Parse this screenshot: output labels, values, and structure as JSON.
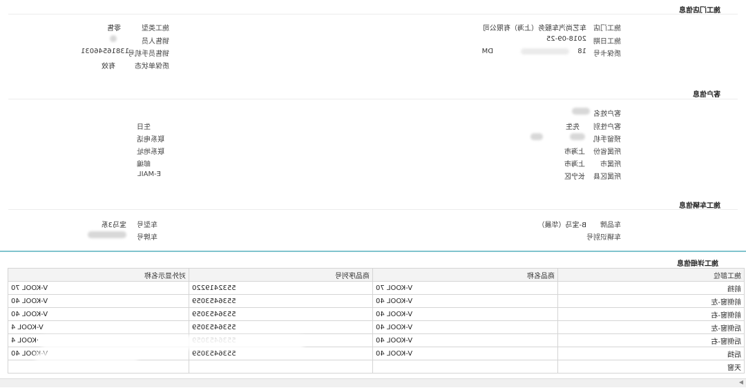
{
  "store_section": {
    "title": "施工门店信息",
    "store_label": "施工门店",
    "store_value": "车艺尚汽车服务（上海）有限公司",
    "date_label": "施工日期",
    "date_value": "2018-09-25",
    "warranty_label": "质保卡号",
    "warranty_value_prefix": "18",
    "warranty_value_suffix": "DM",
    "type_label": "施工类型",
    "type_value": "零售",
    "sales_label": "销售人员",
    "sales_phone_label": "销售员手机号",
    "sales_phone_value": "13816546031",
    "status_label": "质保单状态",
    "status_value": "有效"
  },
  "customer_section": {
    "title": "客户信息",
    "name_label": "客户姓名",
    "gender_label": "客户性别",
    "gender_value": "先生",
    "phone_label": "预留手机",
    "province_label": "所属省份",
    "province_value": "上海市",
    "city_label": "所属市",
    "city_value": "上海市",
    "district_label": "所属区县",
    "district_value": "长宁区",
    "birthday_label": "生日",
    "contact_phone_label": "联系电话",
    "address_label": "联系地址",
    "postcode_label": "邮编",
    "email_label": "E-MAIL"
  },
  "vehicle_section": {
    "title": "施工车辆信息",
    "brand_label": "车品牌",
    "brand_value": "B-宝马（华晨）",
    "vin_label": "车辆识别号",
    "model_label": "车型号",
    "model_value": "宝马3系",
    "plate_label": "车牌号"
  },
  "detail_section": {
    "title": "施工详细信息",
    "columns": [
      "施工部位",
      "商品名称",
      "商品序列号",
      "对外显示名称"
    ],
    "rows": [
      [
        "前挡",
        "V-KOOL 70",
        "5532419220",
        "V-KOOL 70"
      ],
      [
        "前侧窗-左",
        "V-KOOL 40",
        "5536453059",
        "V-KOOL 40"
      ],
      [
        "前侧窗-右",
        "V-KOOL 40",
        "5536453059",
        "V-KOOL 40"
      ],
      [
        "后侧窗-左",
        "V-KOOL 40",
        "5536453059",
        "V-KOOL 4"
      ],
      [
        "后侧窗-右",
        "V-KOOL 40",
        "5536453059",
        "·KOOL 4"
      ],
      [
        "后挡",
        "V-KOOL 40",
        "5536453059",
        "V-KOOL 40"
      ],
      [
        "天窗",
        "",
        "",
        ""
      ]
    ]
  }
}
